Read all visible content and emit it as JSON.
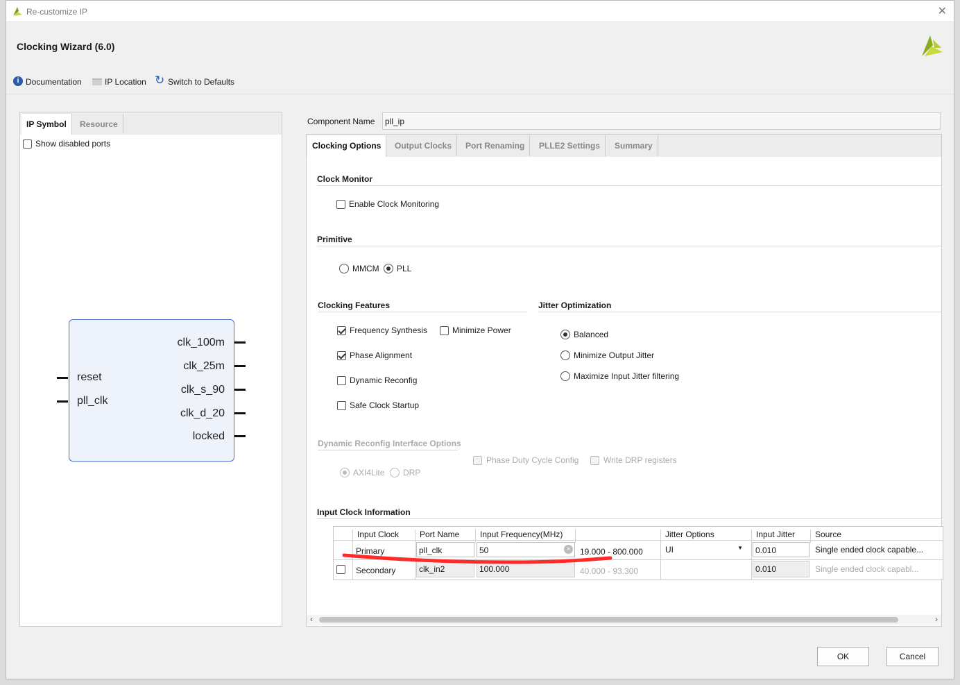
{
  "window": {
    "title": "Re-customize IP"
  },
  "header": {
    "title": "Clocking Wizard (6.0)",
    "documentation": "Documentation",
    "ip_location": "IP Location",
    "switch_defaults": "Switch to Defaults"
  },
  "left": {
    "tabs": [
      "IP Symbol",
      "Resource"
    ],
    "show_disabled_ports": "Show disabled ports",
    "inputs": [
      "reset",
      "pll_clk"
    ],
    "outputs": [
      "clk_100m",
      "clk_25m",
      "clk_s_90",
      "clk_d_20",
      "locked"
    ]
  },
  "component": {
    "label": "Component Name",
    "value": "pll_ip"
  },
  "tabs": [
    "Clocking Options",
    "Output Clocks",
    "Port Renaming",
    "PLLE2 Settings",
    "Summary"
  ],
  "clock_monitor": {
    "title": "Clock Monitor",
    "enable": "Enable Clock Monitoring"
  },
  "primitive": {
    "title": "Primitive",
    "options": [
      "MMCM",
      "PLL"
    ],
    "selected": "PLL"
  },
  "features": {
    "title": "Clocking Features",
    "freq_synth": "Frequency Synthesis",
    "min_power": "Minimize Power",
    "phase_align": "Phase Alignment",
    "dyn_reconfig": "Dynamic Reconfig",
    "safe_startup": "Safe Clock Startup"
  },
  "jitter": {
    "title": "Jitter Optimization",
    "options": [
      "Balanced",
      "Minimize Output Jitter",
      "Maximize Input Jitter filtering"
    ],
    "selected": "Balanced"
  },
  "drp": {
    "title": "Dynamic Reconfig Interface Options",
    "phase_duty": "Phase Duty Cycle Config",
    "write_drp": "Write DRP registers",
    "axi": "AXI4Lite",
    "drp": "DRP"
  },
  "input_clock": {
    "title": "Input Clock Information",
    "headers": [
      "Input Clock",
      "Port Name",
      "Input Frequency(MHz)",
      "",
      "Jitter Options",
      "Input Jitter",
      "Source"
    ],
    "rows": [
      {
        "clock": "Primary",
        "port": "pll_clk",
        "freq": "50",
        "range": "19.000 - 800.000",
        "jitter_opt": "UI",
        "jitter": "0.010",
        "source": "Single ended clock capable..."
      },
      {
        "clock": "Secondary",
        "port": "clk_in2",
        "freq": "100.000",
        "range": "40.000 - 93.300",
        "jitter_opt": "",
        "jitter": "0.010",
        "source": "Single ended clock capabl..."
      }
    ]
  },
  "buttons": {
    "ok": "OK",
    "cancel": "Cancel"
  },
  "colors": {
    "annotation": "#ff2a2a",
    "symbol_fill": "#eef3fb",
    "symbol_border": "#4a6fd0"
  }
}
